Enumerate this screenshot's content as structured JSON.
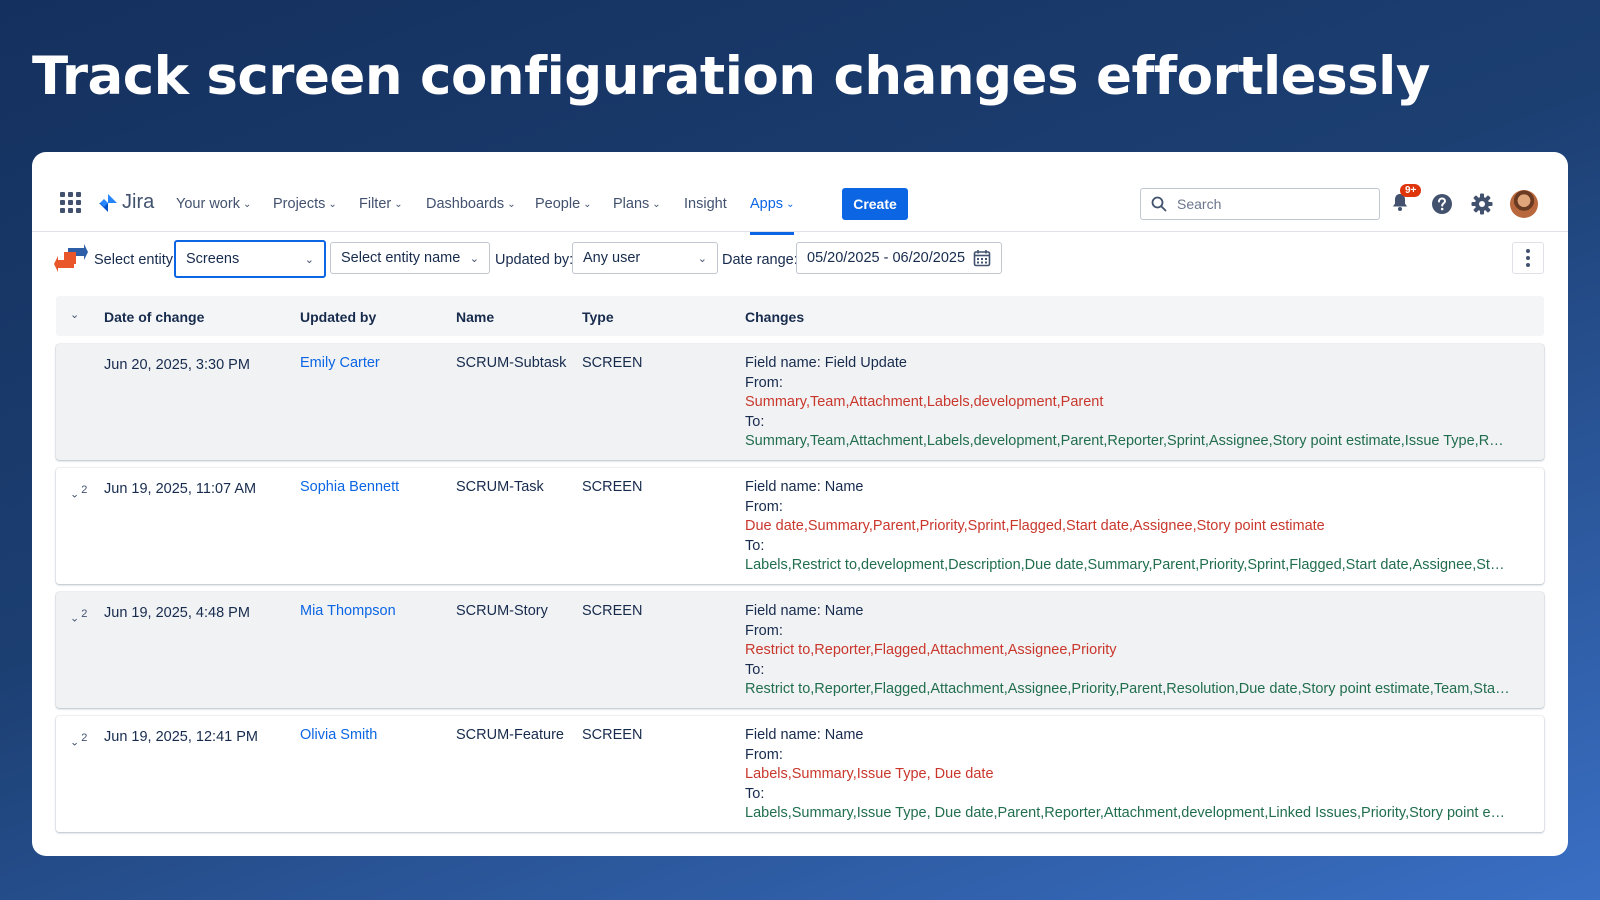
{
  "headline": "Track screen configuration changes effortlessly",
  "nav": {
    "logo_text": "Jira",
    "items": [
      "Your work",
      "Projects",
      "Filter",
      "Dashboards",
      "People",
      "Plans",
      "Insight",
      "Apps"
    ],
    "active_item": "Apps",
    "create_label": "Create",
    "search_placeholder": "Search",
    "notification_badge": "9+"
  },
  "filters": {
    "entity_label": "Select entity:",
    "entity_value": "Screens",
    "entity_name_placeholder": "Select entity name",
    "updated_by_label": "Updated by:",
    "updated_by_value": "Any user",
    "date_range_label": "Date range:",
    "date_range_value": "05/20/2025 - 06/20/2025"
  },
  "table": {
    "headers": [
      "Date of change",
      "Updated by",
      "Name",
      "Type",
      "Changes"
    ],
    "rows": [
      {
        "expand_count": "",
        "date": "Jun 20, 2025, 3:30 PM",
        "user": "Emily Carter",
        "name": "SCRUM-Subtask",
        "type": "SCREEN",
        "field": "Field name: Field Update",
        "from_label": "From:",
        "from": "Summary,Team,Attachment,Labels,development,Parent",
        "to_label": "To:",
        "to": "Summary,Team,Attachment,Labels,development,Parent,Reporter,Sprint,Assignee,Story point estimate,Issue Type,Restrict to,..."
      },
      {
        "expand_count": "2",
        "date": "Jun 19, 2025, 11:07 AM",
        "user": "Sophia Bennett",
        "name": "SCRUM-Task",
        "type": "SCREEN",
        "field": "Field name: Name",
        "from_label": "From:",
        "from": "Due date,Summary,Parent,Priority,Sprint,Flagged,Start date,Assignee,Story point estimate",
        "to_label": "To:",
        "to": "Labels,Restrict to,development,Description,Due date,Summary,Parent,Priority,Sprint,Flagged,Start date,Assignee,Story point..."
      },
      {
        "expand_count": "2",
        "date": "Jun 19, 2025, 4:48 PM",
        "user": "Mia Thompson",
        "name": "SCRUM-Story",
        "type": "SCREEN",
        "field": "Field name: Name",
        "from_label": "From:",
        "from": "Restrict to,Reporter,Flagged,Attachment,Assignee,Priority",
        "to_label": "To:",
        "to": "Restrict to,Reporter,Flagged,Attachment,Assignee,Priority,Parent,Resolution,Due date,Story point estimate,Team,Start date,S..."
      },
      {
        "expand_count": "2",
        "date": "Jun 19, 2025, 12:41 PM",
        "user": "Olivia Smith",
        "name": "SCRUM-Feature",
        "type": "SCREEN",
        "field": "Field name: Name",
        "from_label": "From:",
        "from": "Labels,Summary,Issue Type, Due date",
        "to_label": "To:",
        "to": "Labels,Summary,Issue Type, Due date,Parent,Reporter,Attachment,development,Linked Issues,Priority,Story point estimate,T..."
      }
    ]
  },
  "colors": {
    "brand_blue": "#0c66e4",
    "from_red": "#c9372c",
    "to_green": "#216e4e"
  }
}
